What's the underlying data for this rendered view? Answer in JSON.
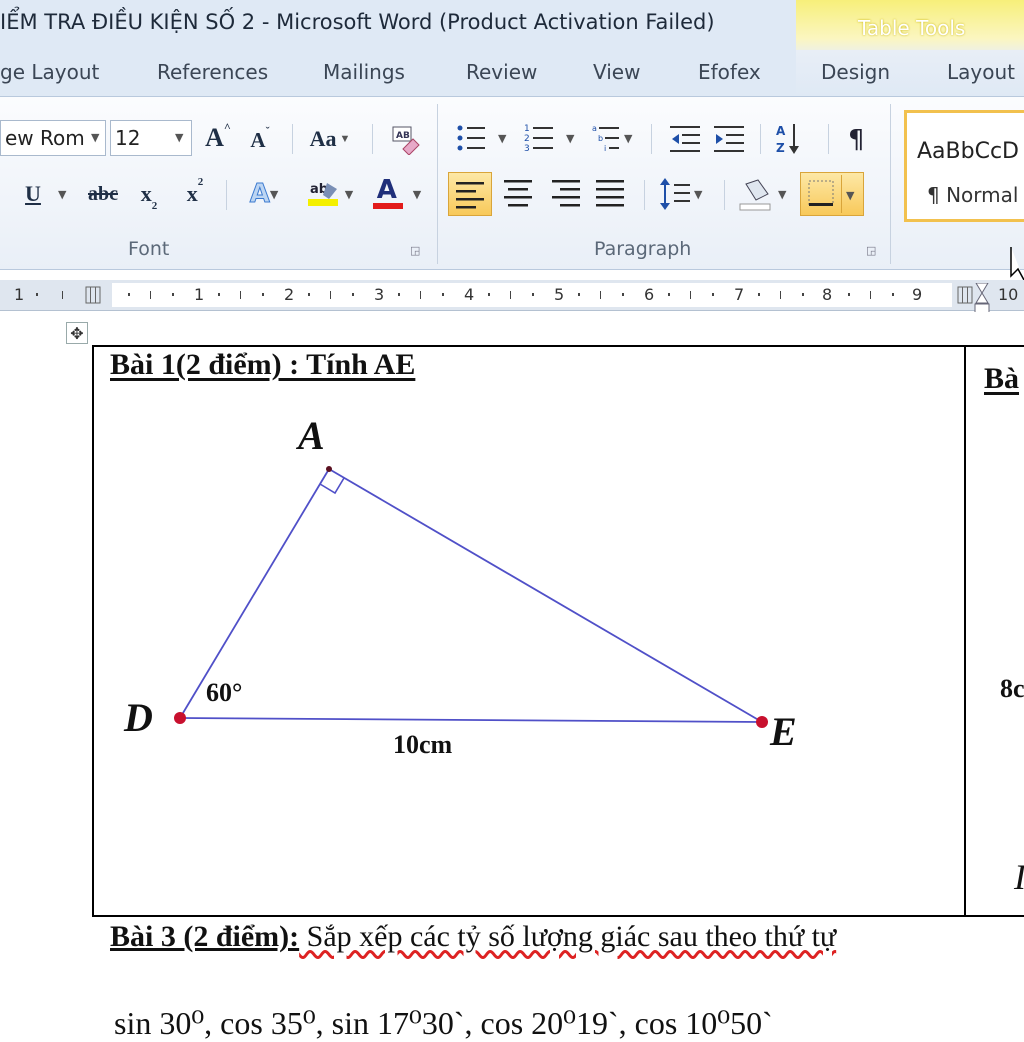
{
  "window": {
    "title": "IỂM TRA ĐIỀU KIỆN SỐ 2  -  Microsoft Word (Product Activation Failed)",
    "contextual_label": "Table Tools"
  },
  "tabs": [
    "ge Layout",
    "References",
    "Mailings",
    "Review",
    "View",
    "Efofex",
    "Design",
    "Layout"
  ],
  "font_group": {
    "font_name": "ew Rom",
    "font_size": "12",
    "label": "Font",
    "grow_glyph": "A",
    "shrink_glyph": "A",
    "case_glyph": "Aa",
    "underline_glyph": "U",
    "strike_glyph": "abc",
    "subscript_glyph": "x",
    "superscript_glyph": "x",
    "font_color_glyph": "A"
  },
  "paragraph_group": {
    "label": "Paragraph",
    "pilcrow": "¶"
  },
  "styles": {
    "preview": "AaBbCcD",
    "name": "¶ Normal"
  },
  "ruler": {
    "numbers": [
      "1",
      "1",
      "2",
      "3",
      "4",
      "5",
      "6",
      "7",
      "8",
      "9",
      "10"
    ]
  },
  "document": {
    "bai1_title": "Bài 1(2 điểm) : Tính AE",
    "vertex_a": "A",
    "vertex_d": "D",
    "vertex_e": "E",
    "angle_label": "60°",
    "side_label": "10cm",
    "right_cell_title": "Bà",
    "right_cell_text": "8c",
    "bai3_title": "Bài 3 (2 điểm):",
    "bai3_text": " Sắp xếp các tỷ số lượng giác sau theo thứ tự",
    "bai3_formula": "sin 30⁰, cos 35⁰, sin 17⁰30`, cos 20⁰19`, cos 10⁰50`"
  },
  "colors": {
    "triangle_line": "#5050c8",
    "point": "#c8102e",
    "ribbon_bg": "#e9eff7",
    "table_tools": "#f5ea6a"
  }
}
